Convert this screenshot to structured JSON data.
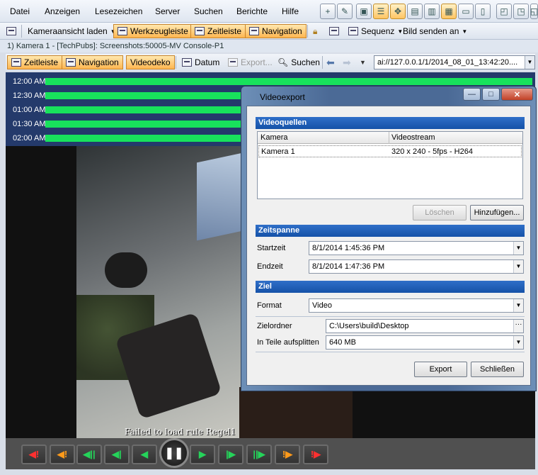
{
  "menu": [
    "Datei",
    "Anzeigen",
    "Lesezeichen",
    "Server",
    "Suchen",
    "Berichte",
    "Hilfe"
  ],
  "toolbar2": {
    "layout": "Kameraansicht laden",
    "werkzeug": "Werkzeugleiste",
    "zeitleiste": "Zeitleiste",
    "navigation": "Navigation",
    "sequenz": "Sequenz",
    "bild_senden": "Bild senden an"
  },
  "panel_title": "1) Kamera 1 - [TechPubs]: Screenshots:50005-MV Console-P1",
  "player": {
    "zeitleiste": "Zeitleiste",
    "navigation": "Navigation",
    "videodeko": "Videodeko",
    "datum": "Datum",
    "export": "Export...",
    "suchen": "Suchen",
    "url": "ai://127.0.0.1/1/2014_08_01_13:42:20...."
  },
  "timeline": {
    "labels": [
      "12:00 AM",
      "12:30 AM",
      "01:00 AM",
      "01:30 AM",
      "02:00 AM"
    ],
    "bar_color": "#18e25c"
  },
  "video": {
    "message": "Failed to load rule Regel1"
  },
  "controls": {
    "icons": [
      "alarm-prev-icon",
      "bookmark-prev-icon",
      "skip-start-icon",
      "step-back-icon",
      "play-back-icon",
      "pause-icon",
      "play-forward-icon",
      "step-forward-icon",
      "skip-end-icon",
      "bookmark-next-icon",
      "alarm-next-icon"
    ]
  },
  "dialog": {
    "title": "Videoexport",
    "sources": {
      "heading": "Videoquellen",
      "col_camera": "Kamera",
      "col_stream": "Videostream",
      "rows": [
        {
          "camera": "Kamera 1",
          "stream": "320 x 240 - 5fps - H264"
        }
      ],
      "remove": "Löschen",
      "add": "Hinzufügen..."
    },
    "range": {
      "heading": "Zeitspanne",
      "start_label": "Startzeit",
      "start_value": "8/1/2014 1:45:36 PM",
      "end_label": "Endzeit",
      "end_value": "8/1/2014 1:47:36 PM"
    },
    "target": {
      "heading": "Ziel",
      "format_label": "Format",
      "format_value": "Video",
      "folder_label": "Zielordner",
      "folder_value": "C:\\Users\\build\\Desktop",
      "split_label": "In Teile aufsplitten",
      "split_value": "640 MB"
    },
    "export_button": "Export",
    "close_button": "Schließen"
  },
  "colors": {
    "timeline_bg": "#243a6b",
    "section_header": "#1552a8",
    "active_toggle": "#ffb650"
  }
}
